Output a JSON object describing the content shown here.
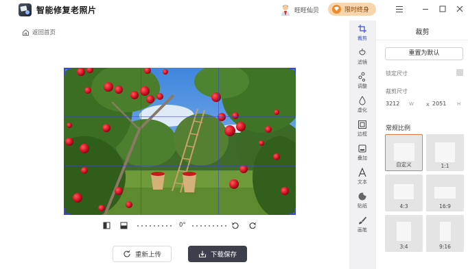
{
  "app": {
    "title": "智能修复老照片"
  },
  "header": {
    "user_name": "旺旺仙贝",
    "vip_label": "限时终身",
    "minimize": "minimize",
    "maximize": "maximize",
    "close": "close"
  },
  "nav": {
    "back_label": "返回首页"
  },
  "editor": {
    "rotation": "0°",
    "reupload_label": "重新上传",
    "save_label": "下载保存"
  },
  "tools": [
    {
      "label": "裁剪",
      "icon": "crop-icon",
      "active": true
    },
    {
      "label": "滤镜",
      "icon": "filter-icon",
      "active": false
    },
    {
      "label": "调整",
      "icon": "adjust-icon",
      "active": false
    },
    {
      "label": "虚化",
      "icon": "blur-icon",
      "active": false
    },
    {
      "label": "边框",
      "icon": "frame-icon",
      "active": false
    },
    {
      "label": "叠加",
      "icon": "overlay-icon",
      "active": false
    },
    {
      "label": "文本",
      "icon": "text-icon",
      "active": false
    },
    {
      "label": "贴纸",
      "icon": "sticker-icon",
      "active": false
    },
    {
      "label": "画笔",
      "icon": "brush-icon",
      "active": false
    }
  ],
  "panel": {
    "title": "裁剪",
    "reset_label": "重置为默认",
    "lock_label": "锁定尺寸",
    "size_label": "裁剪尺寸",
    "width_value": "3212",
    "width_unit": "W",
    "height_value": "2051",
    "height_unit": "H",
    "times": "x",
    "ratio_title": "常规比例",
    "ratios": [
      {
        "label": "自定义",
        "selected": true
      },
      {
        "label": "1:1",
        "selected": false
      },
      {
        "label": "4:3",
        "selected": false
      },
      {
        "label": "16:9",
        "selected": false
      },
      {
        "label": "3:4",
        "selected": false
      },
      {
        "label": "9:16",
        "selected": false
      }
    ]
  },
  "colors": {
    "accent": "#3b48d6",
    "selected_border": "#e07b42",
    "save_button": "#3d3f4c",
    "vip_bg": "#f7d6ad"
  }
}
